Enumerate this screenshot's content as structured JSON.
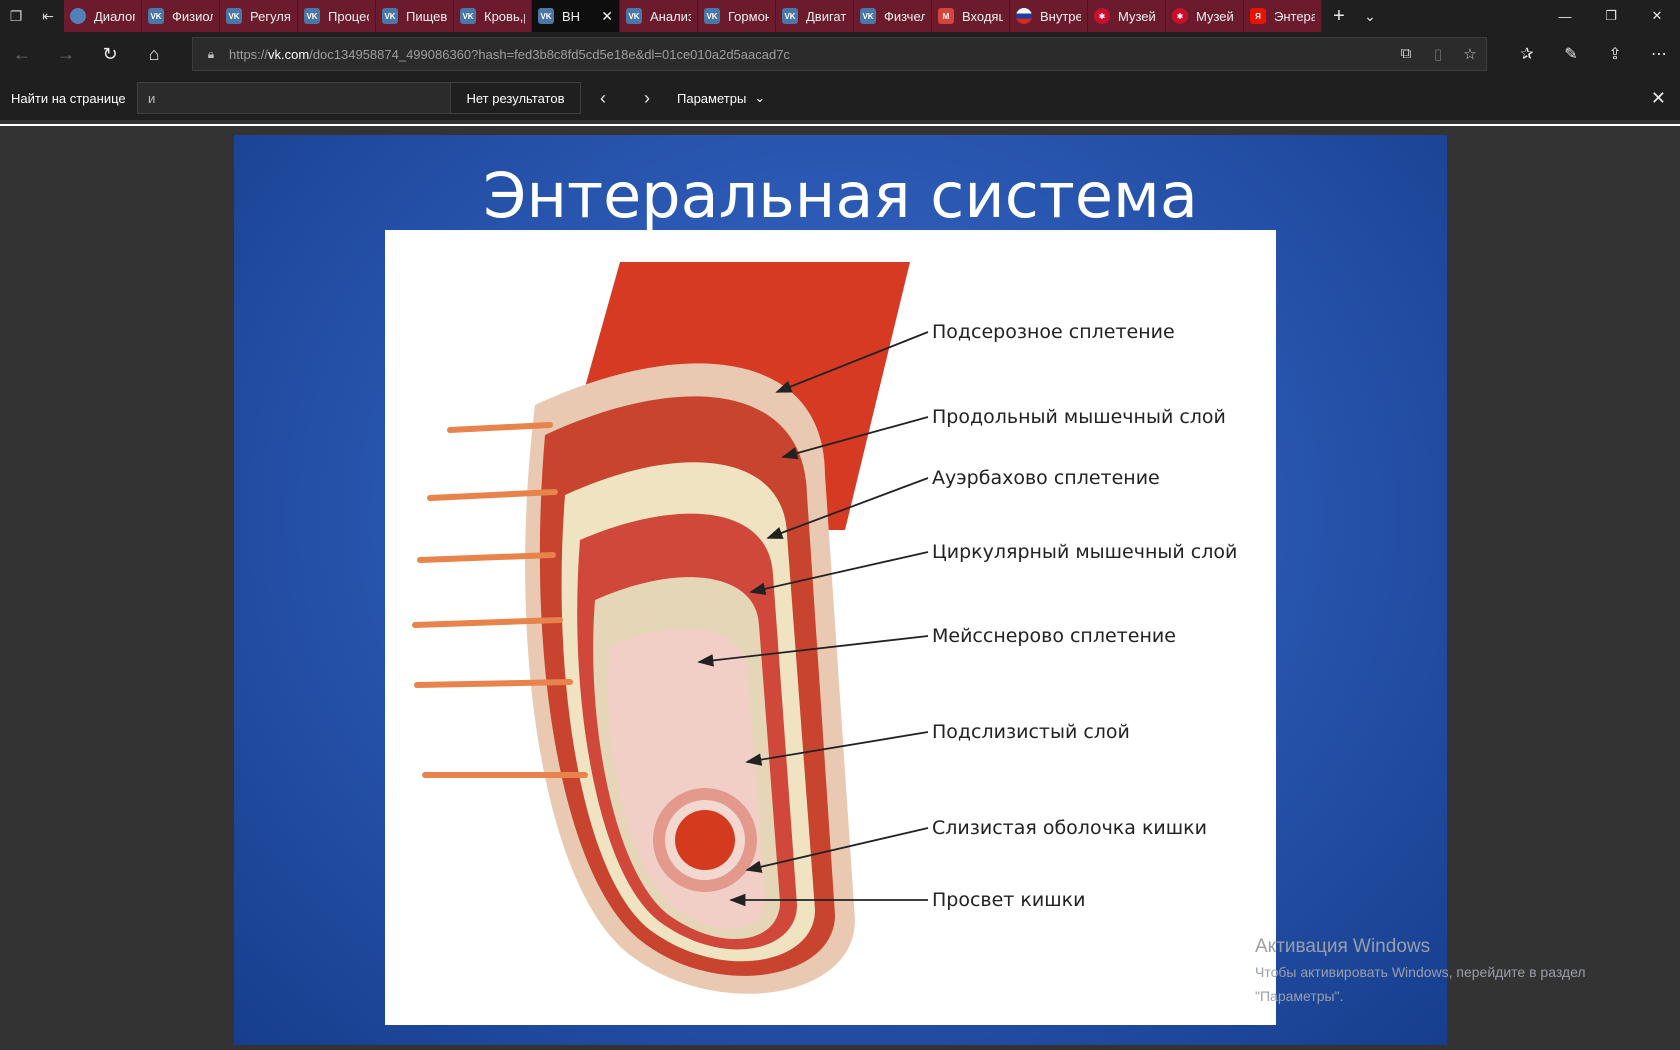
{
  "tabs": [
    {
      "label": "Диалог",
      "favicon": "chat-icon",
      "active": false
    },
    {
      "label": "Физиол",
      "favicon": "vk-icon",
      "active": false
    },
    {
      "label": "Регуляц",
      "favicon": "vk-icon",
      "active": false
    },
    {
      "label": "Процес",
      "favicon": "vk-icon",
      "active": false
    },
    {
      "label": "Пищев",
      "favicon": "vk-icon",
      "active": false
    },
    {
      "label": "Кровь,р",
      "favicon": "vk-icon",
      "active": false
    },
    {
      "label": "ВН",
      "favicon": "vk-icon",
      "active": true
    },
    {
      "label": "Анализ",
      "favicon": "vk-icon",
      "active": false
    },
    {
      "label": "Гормон",
      "favicon": "vk-icon",
      "active": false
    },
    {
      "label": "Двигат",
      "favicon": "vk-icon",
      "active": false
    },
    {
      "label": "Физчел",
      "favicon": "vk-icon",
      "active": false
    },
    {
      "label": "Входящ",
      "favicon": "mail-icon",
      "active": false
    },
    {
      "label": "Внутре",
      "favicon": "russia-flag-icon",
      "active": false
    },
    {
      "label": "Музей",
      "favicon": "museum-icon",
      "active": false
    },
    {
      "label": "Музей",
      "favicon": "museum-icon",
      "active": false
    },
    {
      "label": "Энтера",
      "favicon": "yandex-icon",
      "active": false
    }
  ],
  "address": {
    "prefix": "https://",
    "host": "vk.com",
    "path": "/doc134958874_499086360?hash=fed3b8c8fd5cd5e18e&dl=01ce010a2d5aacad7c"
  },
  "find": {
    "label": "Найти на странице",
    "query": "и",
    "result": "Нет результатов",
    "options": "Параметры"
  },
  "slide": {
    "title": "Энтеральная система",
    "labels": [
      "Подсерозное сплетение",
      "Продольный мышечный слой",
      "Ауэрбахово сплетение",
      "Циркулярный мышечный слой",
      "Мейсснерово сплетение",
      "Подслизистый слой",
      "Слизистая оболочка кишки",
      "Просвет кишки"
    ]
  },
  "watermark": {
    "title": "Активация Windows",
    "line1": "Чтобы активировать Windows, перейдите в раздел",
    "line2": "\"Параметры\"."
  },
  "colors": {
    "tab_bar": "#1f1f1f",
    "inactive_tab": "#6b1b2c",
    "slide_blue": "#2a58b2",
    "muscle_red": "#c8442e"
  }
}
